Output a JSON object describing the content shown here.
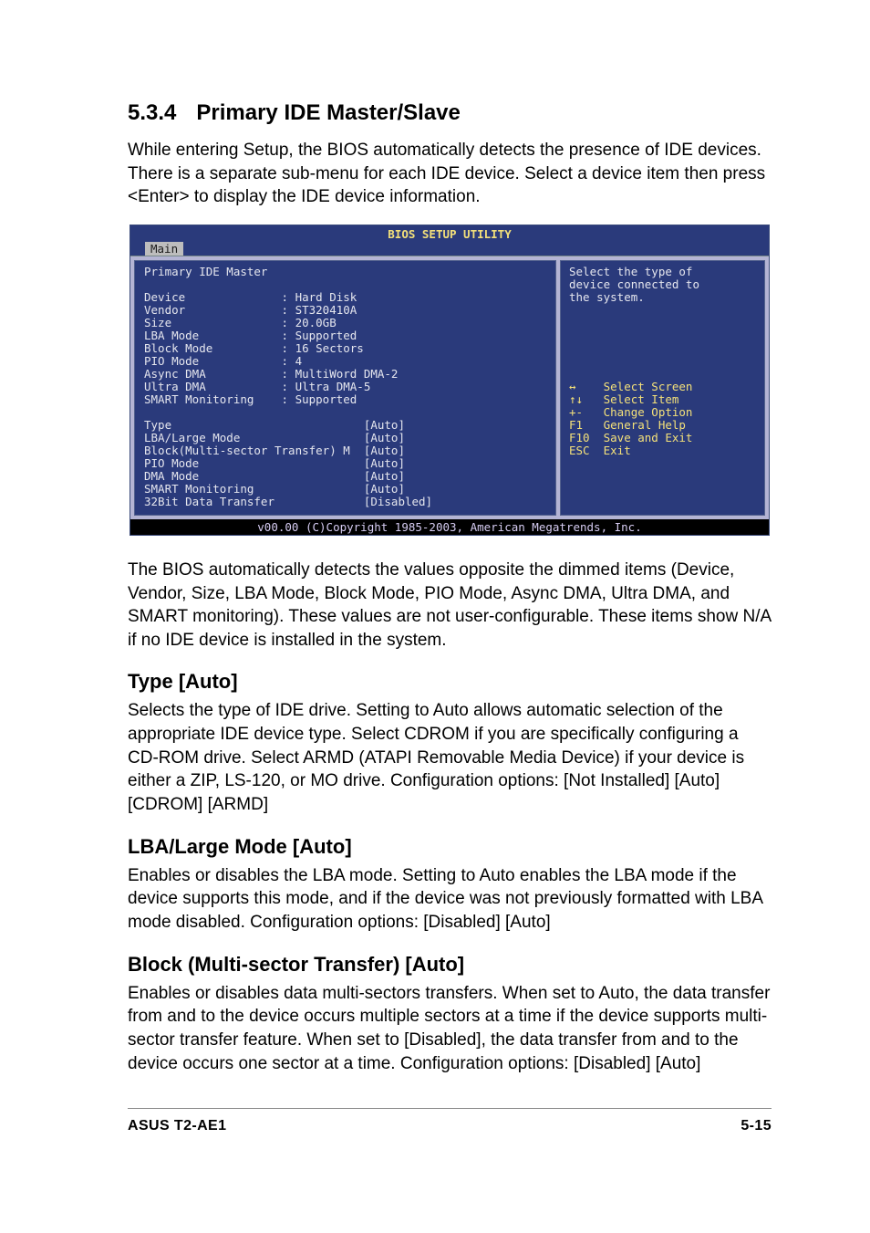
{
  "header": {
    "num": "5.3.4",
    "title": "Primary IDE Master/Slave"
  },
  "intro": "While entering Setup, the BIOS automatically detects the presence of IDE devices. There is a separate sub-menu for each IDE device. Select a device item then press <Enter> to display the IDE device information.",
  "bios": {
    "title": "BIOS SETUP UTILITY",
    "tab": "Main",
    "left_pre": "Primary IDE Master\n\nDevice              : Hard Disk\nVendor              : ST320410A\nSize                : 20.0GB\nLBA Mode            : Supported\nBlock Mode          : 16 Sectors\nPIO Mode            : 4\nAsync DMA           : MultiWord DMA-2\nUltra DMA           : Ultra DMA-5\nSMART Monitoring    : Supported\n\nType                            [Auto]\nLBA/Large Mode                  [Auto]\nBlock(Multi-sector Transfer) M  [Auto]\nPIO Mode                        [Auto]\nDMA Mode                        [Auto]\nSMART Monitoring                [Auto]\n32Bit Data Transfer             [Disabled]",
    "right_desc": "Select the type of\ndevice connected to\nthe system.",
    "right_keys": "\n\n\n\n\n\n\n↔    Select Screen\n↑↓   Select Item\n+-   Change Option\nF1   General Help\nF10  Save and Exit\nESC  Exit",
    "footer": "v00.00 (C)Copyright 1985-2003, American Megatrends, Inc."
  },
  "para_after_bios": "The BIOS automatically detects the values opposite the dimmed items (Device, Vendor, Size, LBA Mode, Block Mode, PIO Mode, Async DMA, Ultra DMA, and SMART monitoring). These values are not user-configurable. These items show N/A if no IDE device is installed in the system.",
  "sections": {
    "type": {
      "heading": "Type [Auto]",
      "body": "Selects the type of IDE drive. Setting to Auto allows automatic selection of the appropriate IDE device type. Select CDROM if you are specifically configuring a CD-ROM drive. Select ARMD (ATAPI Removable Media Device) if your device is either a ZIP, LS-120, or MO drive. Configuration options: [Not Installed] [Auto] [CDROM] [ARMD]"
    },
    "lba": {
      "heading": "LBA/Large Mode [Auto]",
      "body": "Enables or disables the LBA mode. Setting to Auto enables the LBA mode if the device supports this mode, and if the device was not previously formatted with LBA mode disabled. Configuration options: [Disabled] [Auto]"
    },
    "block": {
      "heading": "Block (Multi-sector Transfer) [Auto]",
      "body": "Enables or disables data multi-sectors transfers. When set to Auto, the data transfer from and to the device occurs multiple sectors at a time if the device supports multi-sector transfer feature. When set to [Disabled], the data transfer from and to the device occurs one sector at a time. Configuration options: [Disabled] [Auto]"
    }
  },
  "footer": {
    "left": "ASUS T2-AE1",
    "right": "5-15"
  }
}
